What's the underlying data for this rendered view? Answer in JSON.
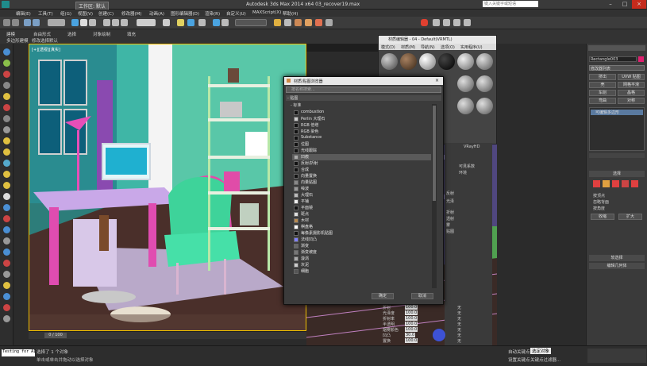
{
  "window": {
    "title": "Autodesk 3ds Max  2014 x64     03_recover19.max",
    "workspace": "工作区: 默认",
    "search_placeholder": "键入关键字或短语"
  },
  "menu": [
    "编辑(E)",
    "工具(T)",
    "组(G)",
    "视图(V)",
    "创建(C)",
    "修改器(M)",
    "动画(A)",
    "图形编辑器(D)",
    "渲染(R)",
    "自定义(U)",
    "MAXScript(X)",
    "帮助(H)"
  ],
  "ribbon": {
    "row1": [
      "建模",
      "自由形式",
      "选择",
      "对象绘制",
      "填充"
    ],
    "row2": [
      "多边形建模",
      "修改选择",
      "默认"
    ]
  },
  "viewport": {
    "label": "[+][透视][真实]"
  },
  "material_editor": {
    "title": "材质编辑器 - 04 - Default(VRMTL)",
    "menu": [
      "模式(D)",
      "材质(M)",
      "导航(N)",
      "选项(O)",
      "实用程序(U)"
    ]
  },
  "browser": {
    "title": "材质/贴图浏览器",
    "search_placeholder": "按名称搜索...",
    "section": "- 贴图",
    "subsection": "- 标准",
    "items": [
      "combustion",
      "Perlin 大理石",
      "RGB 倍增",
      "RGB 染色",
      "Substance",
      "位图",
      "光线跟踪",
      "凹痕",
      "反射/折射",
      "合成",
      "向量置换",
      "向量贴图",
      "噪波",
      "大理石",
      "平铺",
      "平面镜",
      "斑点",
      "木材",
      "棋盘格",
      "每像素摄影机贴图",
      "法线凹凸",
      "渐变",
      "渐变坡度",
      "漩涡",
      "灰泥",
      "细胞"
    ],
    "ok": "确定",
    "cancel": "取消"
  },
  "mid_panel": {
    "labels": [
      "折射",
      "光泽度",
      "折射率",
      "半透明",
      "烟雾颜色",
      "凹凸",
      "置换",
      "不透明度",
      "环境"
    ],
    "values": [
      "100.0",
      "100.0",
      "100.0",
      "100.0",
      "100.0",
      "30.0",
      "100.0",
      "100.0",
      "100.0"
    ],
    "none": "无",
    "side": [
      "可見系数",
      "环境",
      "VRayHD",
      "反射",
      "光泽",
      "折射",
      "透射",
      "雾",
      "贴图"
    ]
  },
  "command_panel": {
    "object_name": "Rectangle003",
    "modifier_list": "修改器列表",
    "buttons": [
      "挤出",
      "UVW 贴图",
      "壳",
      "网格平滑",
      "车削",
      "晶格",
      "弯曲",
      "对称"
    ],
    "stack_item": "可编辑多边形",
    "selection_title": "选择",
    "soft_selection": "软选择",
    "edit_geometry": "编辑几何体",
    "checkboxes": [
      "按顶点",
      "忽略背面",
      "按角度",
      "收缩",
      "扩大"
    ]
  },
  "status": {
    "selected": "选择了 1 个对象",
    "prompt": "单击或单击并拖动以选择对象",
    "script": "Testing for AI",
    "auto_key": "自动关键点",
    "selected_obj": "选定对象",
    "set_key": "设置关键点",
    "key_filters": "关键点过滤器...",
    "frame": "0 / 100"
  },
  "colors": {
    "accent": "#f0c000",
    "viewport_bg": "#2a6f6f",
    "chair": "#3ed39a",
    "desk": "#c9a8e8",
    "pink": "#e04cb0"
  }
}
